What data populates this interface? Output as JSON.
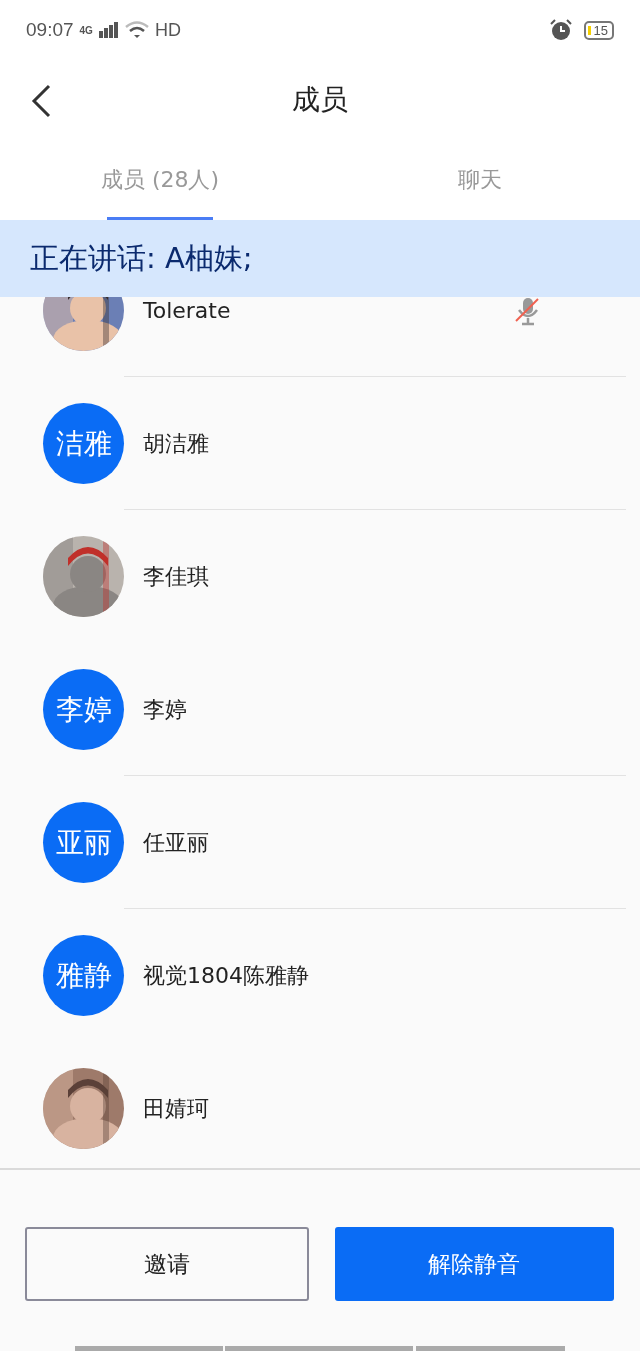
{
  "status_bar": {
    "time": "09:07",
    "network": "4G",
    "hd": "HD",
    "battery": "15"
  },
  "header": {
    "title": "成员"
  },
  "tabs": [
    {
      "label": "成员 (28人)",
      "selected": true
    },
    {
      "label": "聊天",
      "selected": false
    }
  ],
  "speaking_banner": "正在讲话: A柚妹;",
  "members": [
    {
      "name": "Tolerate",
      "muted": true,
      "divider": true
    },
    {
      "name": "胡洁雅",
      "avatar": {
        "kind": "initials",
        "text": "洁雅"
      },
      "muted": false,
      "divider": true
    },
    {
      "name": "李佳琪",
      "muted": false,
      "divider": false
    },
    {
      "name": "李婷",
      "avatar": {
        "kind": "initials",
        "text": "李婷"
      },
      "muted": false,
      "divider": true
    },
    {
      "name": "任亚丽",
      "avatar": {
        "kind": "initials",
        "text": "亚丽"
      },
      "muted": false,
      "divider": true
    },
    {
      "name": "视觉1804陈雅静",
      "avatar": {
        "kind": "initials",
        "text": "雅静"
      },
      "muted": false,
      "divider": false
    },
    {
      "name": "田婧珂",
      "muted": false,
      "divider": false
    }
  ],
  "buttons": [
    {
      "label": "邀请",
      "kind": "outline"
    },
    {
      "label": "解除静音",
      "kind": "primary"
    }
  ]
}
